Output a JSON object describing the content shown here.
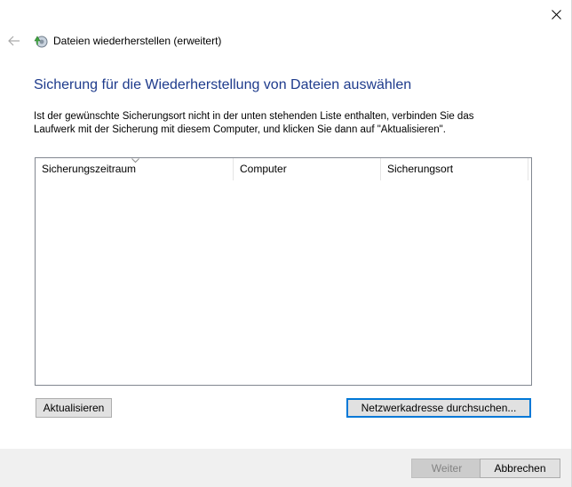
{
  "window": {
    "title": "Dateien wiederherstellen (erweitert)",
    "close_icon": "close-icon",
    "back_icon": "back-arrow-icon",
    "app_icon": "restore-files-icon"
  },
  "page": {
    "heading": "Sicherung für die Wiederherstellung von Dateien auswählen",
    "instruction": "Ist der gewünschte Sicherungsort nicht in der unten stehenden Liste enthalten, verbinden Sie das Laufwerk mit der Sicherung mit diesem Computer, und klicken Sie dann auf \"Aktualisieren\".",
    "heading_color": "#1e3b8c"
  },
  "backup_list": {
    "columns": [
      {
        "label": "Sicherungszeitraum",
        "sorted": true
      },
      {
        "label": "Computer",
        "sorted": false
      },
      {
        "label": "Sicherungsort",
        "sorted": false
      }
    ],
    "rows": []
  },
  "buttons": {
    "refresh": "Aktualisieren",
    "browse_network": "Netzwerkadresse durchsuchen...",
    "next": "Weiter",
    "cancel": "Abbrechen"
  },
  "colors": {
    "focus_border": "#0078d7",
    "footer_background": "#f0f0f0"
  }
}
